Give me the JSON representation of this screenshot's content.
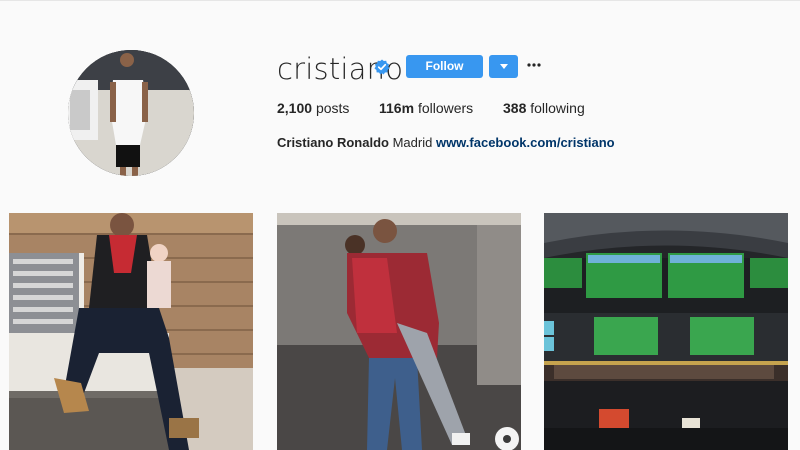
{
  "profile": {
    "username": "cristiano",
    "verified": true,
    "follow_label": "Follow",
    "stats": {
      "posts_count": "2,100",
      "posts_label": "posts",
      "followers_count": "116m",
      "followers_label": "followers",
      "following_count": "388",
      "following_label": "following"
    },
    "bio": {
      "full_name": "Cristiano Ronaldo",
      "text": "Madrid",
      "link": "www.facebook.com/cristiano"
    }
  },
  "icons": {
    "verified": "verified-badge-icon",
    "dropdown": "chevron-down-icon",
    "more": "more-options-icon"
  },
  "colors": {
    "accent": "#3897f0",
    "link": "#003569",
    "background": "#fafafa",
    "text": "#262626"
  }
}
